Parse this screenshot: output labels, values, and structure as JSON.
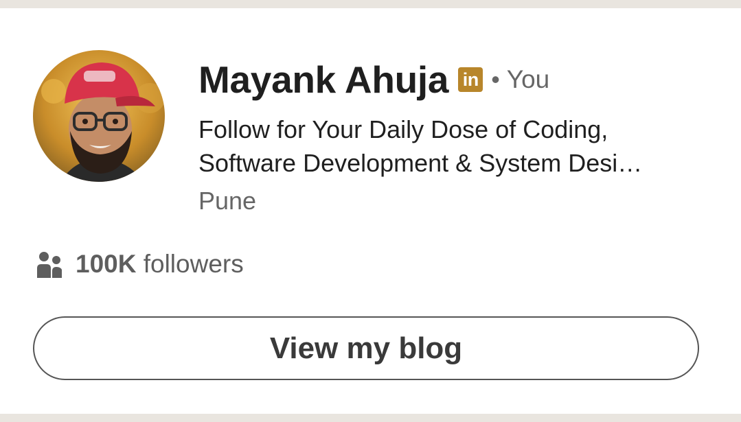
{
  "profile": {
    "name": "Mayank Ahuja",
    "badge": "in",
    "separator": "•",
    "relation": "You",
    "headline_line1": "Follow for Your Daily Dose of Coding,",
    "headline_line2": "Software Development & System Desi…",
    "location": "Pune"
  },
  "followers": {
    "count": "100K",
    "label": " followers",
    "icon": "people-icon"
  },
  "action": {
    "button_label": "View my blog"
  },
  "colors": {
    "badge": "#b8862b",
    "primary_text": "#1f1f1f",
    "secondary_text": "#666666",
    "button_border": "#555555"
  }
}
